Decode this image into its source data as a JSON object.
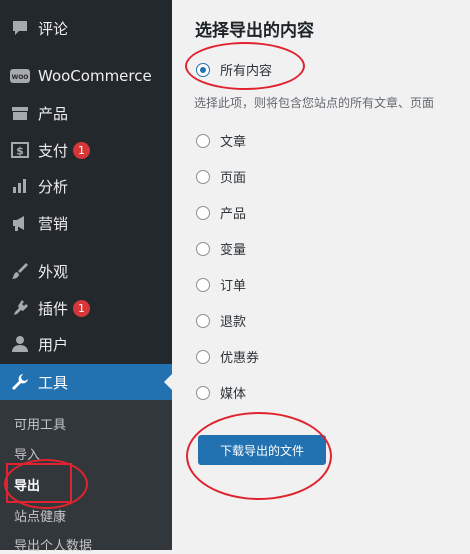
{
  "sidebar": {
    "items": [
      {
        "label": "评论",
        "icon": "comment-icon"
      },
      {
        "label": "WooCommerce",
        "icon": "woocommerce-icon"
      },
      {
        "label": "产品",
        "icon": "archive-icon"
      },
      {
        "label": "支付",
        "icon": "payment-icon",
        "badge": "1"
      },
      {
        "label": "分析",
        "icon": "bar-chart-icon"
      },
      {
        "label": "营销",
        "icon": "megaphone-icon"
      },
      {
        "label": "外观",
        "icon": "paint-brush-icon"
      },
      {
        "label": "插件",
        "icon": "plugin-icon",
        "badge": "1"
      },
      {
        "label": "用户",
        "icon": "user-icon"
      },
      {
        "label": "工具",
        "icon": "wrench-icon",
        "active": true
      }
    ],
    "woo_logo_text": "WOO",
    "submenu": [
      {
        "label": "可用工具"
      },
      {
        "label": "导入"
      },
      {
        "label": "导出",
        "current": true
      },
      {
        "label": "站点健康"
      },
      {
        "label": "导出个人数据"
      }
    ]
  },
  "main": {
    "title": "选择导出的内容",
    "options": [
      {
        "label": "所有内容",
        "checked": true
      },
      {
        "label": "文章"
      },
      {
        "label": "页面"
      },
      {
        "label": "产品"
      },
      {
        "label": "变量"
      },
      {
        "label": "订单"
      },
      {
        "label": "退款"
      },
      {
        "label": "优惠券"
      },
      {
        "label": "媒体"
      }
    ],
    "description": "选择此项，则将包含您站点的所有文章、页面",
    "download_button": "下载导出的文件"
  },
  "colors": {
    "sidebar_bg": "#23282d",
    "active_bg": "#2271b1",
    "annotation_red": "#e0242f",
    "badge_red": "#d63638"
  }
}
